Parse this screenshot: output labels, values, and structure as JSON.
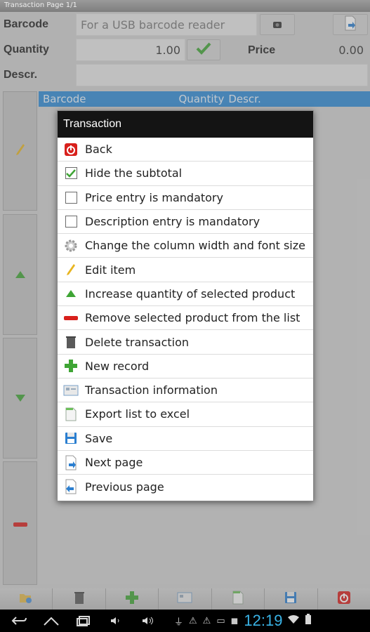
{
  "window": {
    "title": "Transaction Page 1/1"
  },
  "form": {
    "barcode_label": "Barcode",
    "barcode_placeholder": "For a USB barcode reader",
    "quantity_label": "Quantity",
    "quantity_value": "1.00",
    "price_label": "Price",
    "price_value": "0.00",
    "descr_label": "Descr."
  },
  "list": {
    "columns": [
      "Barcode",
      "Quantity",
      "Descr."
    ]
  },
  "menu": {
    "title": "Transaction",
    "items": [
      {
        "label": "Back",
        "icon": "power-icon"
      },
      {
        "label": "Hide the subtotal",
        "icon": "checkbox-checked-icon",
        "checked": true
      },
      {
        "label": "Price entry is mandatory",
        "icon": "checkbox-empty-icon",
        "checked": false
      },
      {
        "label": "Description entry is mandatory",
        "icon": "checkbox-empty-icon",
        "checked": false
      },
      {
        "label": "Change the column width and font size",
        "icon": "gear-icon"
      },
      {
        "label": "Edit item",
        "icon": "pencil-icon"
      },
      {
        "label": "Increase quantity of selected product",
        "icon": "triangle-up-icon"
      },
      {
        "label": "Remove selected product from the list",
        "icon": "minus-icon"
      },
      {
        "label": "Delete transaction",
        "icon": "trash-icon"
      },
      {
        "label": "New record",
        "icon": "plus-icon"
      },
      {
        "label": "Transaction information",
        "icon": "info-card-icon"
      },
      {
        "label": "Export list to excel",
        "icon": "document-icon"
      },
      {
        "label": "Save",
        "icon": "floppy-icon"
      },
      {
        "label": "Next page",
        "icon": "next-page-icon"
      },
      {
        "label": "Previous page",
        "icon": "previous-page-icon"
      }
    ]
  },
  "status": {
    "time": "12:19"
  },
  "colors": {
    "accent": "#2f8ad6",
    "clock": "#39b3e6",
    "red": "#d8201c",
    "green": "#3fa535"
  }
}
